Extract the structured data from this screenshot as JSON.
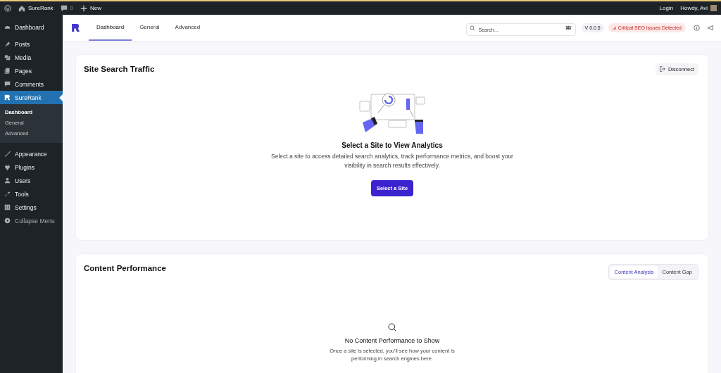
{
  "admin_bar": {
    "site": "SureRank",
    "comments": "0",
    "new": "New",
    "login": "Login",
    "howdy": "Howdy, Avi"
  },
  "sidebar": {
    "items": [
      {
        "label": "Dashboard",
        "selected": false
      },
      {
        "label": "Posts",
        "selected": false
      },
      {
        "label": "Media",
        "selected": false
      },
      {
        "label": "Pages",
        "selected": false
      },
      {
        "label": "Comments",
        "selected": false
      },
      {
        "label": "SureRank",
        "selected": true,
        "children": [
          {
            "label": "Dashboard",
            "selected": true
          },
          {
            "label": "General",
            "selected": false
          },
          {
            "label": "Advanced",
            "selected": false
          }
        ]
      },
      {
        "label": "Appearance",
        "selected": false
      },
      {
        "label": "Plugins",
        "selected": false
      },
      {
        "label": "Users",
        "selected": false
      },
      {
        "label": "Tools",
        "selected": false
      },
      {
        "label": "Settings",
        "selected": false
      },
      {
        "label": "Collapse Menu",
        "selected": false
      }
    ]
  },
  "header": {
    "tabs": [
      {
        "label": "Dashboard",
        "selected": true
      },
      {
        "label": "General",
        "selected": false
      },
      {
        "label": "Advanced",
        "selected": false
      }
    ],
    "search": {
      "placeholder": "Search...",
      "shortcut": "⌘/"
    },
    "version": "V 0.0.5",
    "alert": "Critical SEO Issues Detected"
  },
  "traffic_card": {
    "title": "Site Search Traffic",
    "disconnect": "Disconnect",
    "heading": "Select a Site to View Analytics",
    "text": "Select a site to access detailed search analytics, track performance metrics, and boost your visibility in search results effectively.",
    "button": "Select a Site"
  },
  "performance_card": {
    "title": "Content Performance",
    "tabs": [
      {
        "label": "Content Analysis",
        "selected": true
      },
      {
        "label": "Content Gap",
        "selected": false
      }
    ],
    "heading": "No Content Performance to Show",
    "text": "Once a site is selected, you'll see how your content is performing in search engines here."
  }
}
